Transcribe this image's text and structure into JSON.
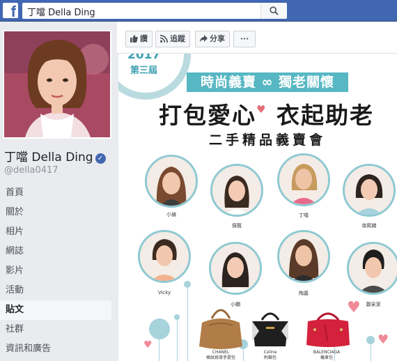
{
  "topbar": {
    "search_value": "丁噹 Della Ding",
    "logo_letter": "f"
  },
  "profile": {
    "name": "丁噹 Della Ding",
    "handle": "@della0417",
    "verified_mark": "✓"
  },
  "nav": [
    {
      "label": "首頁",
      "active": false
    },
    {
      "label": "關於",
      "active": false
    },
    {
      "label": "相片",
      "active": false
    },
    {
      "label": "網誌",
      "active": false
    },
    {
      "label": "影片",
      "active": false
    },
    {
      "label": "活動",
      "active": false
    },
    {
      "label": "貼文",
      "active": true
    },
    {
      "label": "社群",
      "active": false
    },
    {
      "label": "資訊和廣告",
      "active": false
    }
  ],
  "actions": {
    "like": "讚",
    "follow": "追蹤",
    "share": "分享",
    "more": "···"
  },
  "cover": {
    "year": "2017",
    "edition": "第三屆",
    "banner": "時尚義賣 ∞ 獨老關懷",
    "headline_a": "打包愛心",
    "headline_b": "衣起助老",
    "subtitle": "二手精品義賣會",
    "celebrities": [
      "小禎",
      "佩甄",
      "丁噹",
      "徐熙娣",
      "Vicky",
      "小嫻",
      "陶嘉",
      "鄭采潔"
    ],
    "bags": [
      {
        "brand": "CHANEL",
        "desc": "格紋肩背手提包"
      },
      {
        "brand": "Celine",
        "desc": "附鎖包"
      },
      {
        "brand": "BALENCIAGA",
        "desc": "機車包"
      }
    ]
  },
  "colors": {
    "fb_blue": "#4267b2",
    "teal": "#57b7c3",
    "pink": "#f08a97"
  }
}
